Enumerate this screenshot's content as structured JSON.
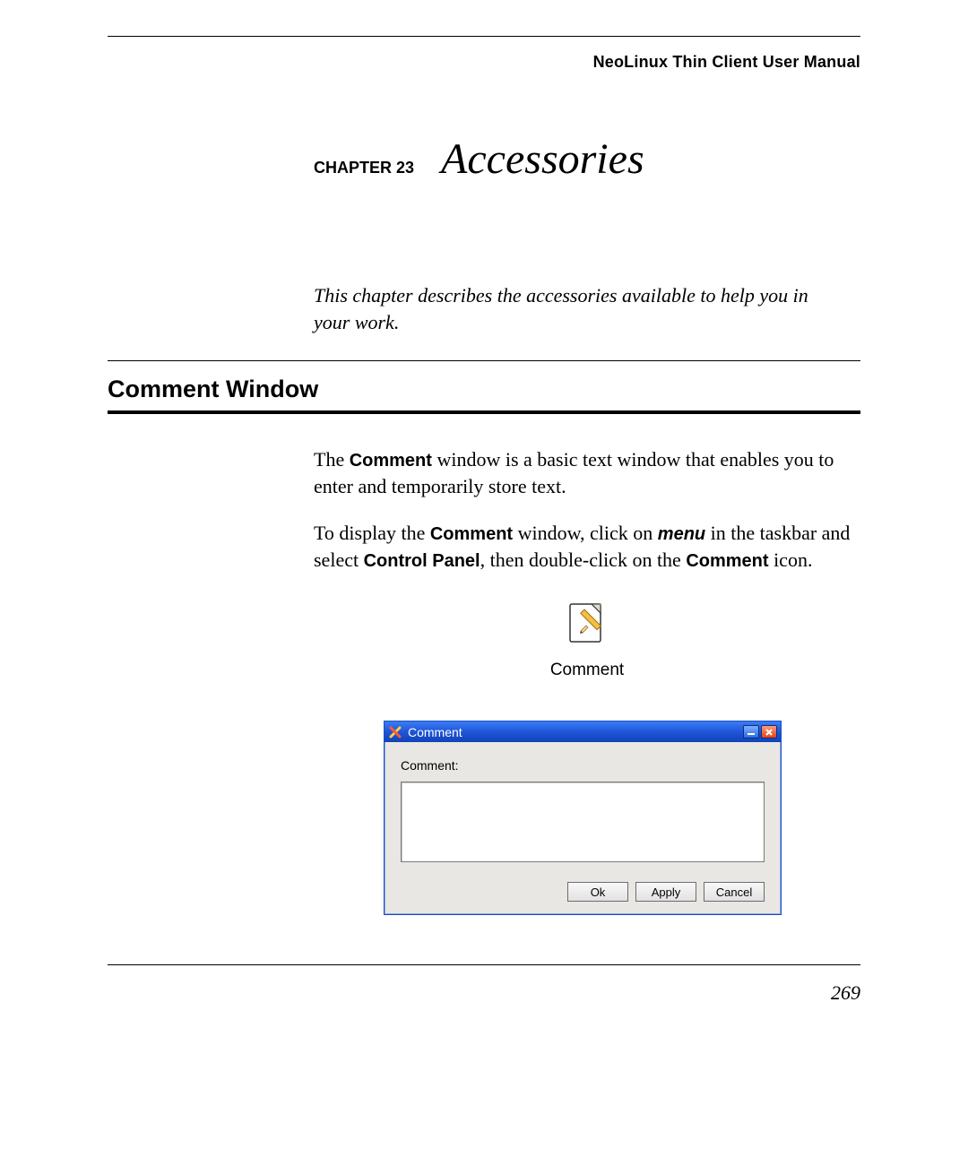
{
  "header": {
    "running_head": "NeoLinux Thin Client User Manual"
  },
  "chapter": {
    "label": "CHAPTER 23",
    "title": "Accessories",
    "description": "This chapter describes the accessories available to help you in your work."
  },
  "section": {
    "title": "Comment Window"
  },
  "body": {
    "p1_a": "The ",
    "p1_term1": "Comment",
    "p1_b": " window is a basic text window that enables you to enter and temporarily store text.",
    "p2_a": "To display the ",
    "p2_term1": "Comment",
    "p2_b": " window, click on ",
    "p2_menu": "menu",
    "p2_c": " in the taskbar and select ",
    "p2_term2": "Control Panel",
    "p2_d": ", then double-click on the ",
    "p2_term3": "Comment",
    "p2_e": " icon."
  },
  "icon": {
    "caption": "Comment"
  },
  "window": {
    "title": "Comment",
    "field_label": "Comment:",
    "ok": "Ok",
    "apply": "Apply",
    "cancel": "Cancel"
  },
  "footer": {
    "page_number": "269"
  }
}
